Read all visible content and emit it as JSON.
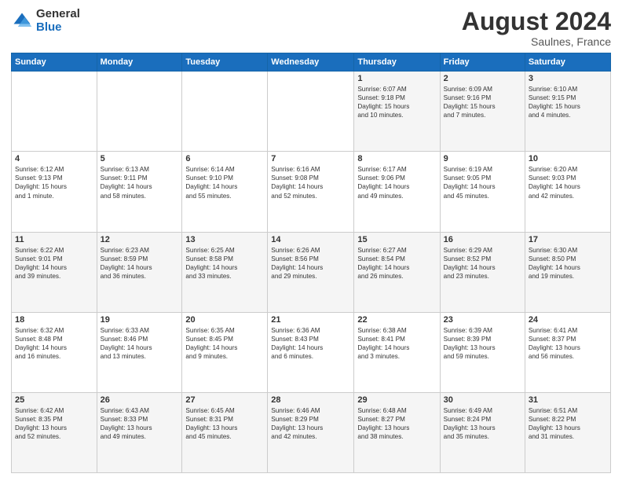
{
  "header": {
    "logo_general": "General",
    "logo_blue": "Blue",
    "month_year": "August 2024",
    "location": "Saulnes, France"
  },
  "weekdays": [
    "Sunday",
    "Monday",
    "Tuesday",
    "Wednesday",
    "Thursday",
    "Friday",
    "Saturday"
  ],
  "weeks": [
    [
      {
        "day": "",
        "info": ""
      },
      {
        "day": "",
        "info": ""
      },
      {
        "day": "",
        "info": ""
      },
      {
        "day": "",
        "info": ""
      },
      {
        "day": "1",
        "info": "Sunrise: 6:07 AM\nSunset: 9:18 PM\nDaylight: 15 hours\nand 10 minutes."
      },
      {
        "day": "2",
        "info": "Sunrise: 6:09 AM\nSunset: 9:16 PM\nDaylight: 15 hours\nand 7 minutes."
      },
      {
        "day": "3",
        "info": "Sunrise: 6:10 AM\nSunset: 9:15 PM\nDaylight: 15 hours\nand 4 minutes."
      }
    ],
    [
      {
        "day": "4",
        "info": "Sunrise: 6:12 AM\nSunset: 9:13 PM\nDaylight: 15 hours\nand 1 minute."
      },
      {
        "day": "5",
        "info": "Sunrise: 6:13 AM\nSunset: 9:11 PM\nDaylight: 14 hours\nand 58 minutes."
      },
      {
        "day": "6",
        "info": "Sunrise: 6:14 AM\nSunset: 9:10 PM\nDaylight: 14 hours\nand 55 minutes."
      },
      {
        "day": "7",
        "info": "Sunrise: 6:16 AM\nSunset: 9:08 PM\nDaylight: 14 hours\nand 52 minutes."
      },
      {
        "day": "8",
        "info": "Sunrise: 6:17 AM\nSunset: 9:06 PM\nDaylight: 14 hours\nand 49 minutes."
      },
      {
        "day": "9",
        "info": "Sunrise: 6:19 AM\nSunset: 9:05 PM\nDaylight: 14 hours\nand 45 minutes."
      },
      {
        "day": "10",
        "info": "Sunrise: 6:20 AM\nSunset: 9:03 PM\nDaylight: 14 hours\nand 42 minutes."
      }
    ],
    [
      {
        "day": "11",
        "info": "Sunrise: 6:22 AM\nSunset: 9:01 PM\nDaylight: 14 hours\nand 39 minutes."
      },
      {
        "day": "12",
        "info": "Sunrise: 6:23 AM\nSunset: 8:59 PM\nDaylight: 14 hours\nand 36 minutes."
      },
      {
        "day": "13",
        "info": "Sunrise: 6:25 AM\nSunset: 8:58 PM\nDaylight: 14 hours\nand 33 minutes."
      },
      {
        "day": "14",
        "info": "Sunrise: 6:26 AM\nSunset: 8:56 PM\nDaylight: 14 hours\nand 29 minutes."
      },
      {
        "day": "15",
        "info": "Sunrise: 6:27 AM\nSunset: 8:54 PM\nDaylight: 14 hours\nand 26 minutes."
      },
      {
        "day": "16",
        "info": "Sunrise: 6:29 AM\nSunset: 8:52 PM\nDaylight: 14 hours\nand 23 minutes."
      },
      {
        "day": "17",
        "info": "Sunrise: 6:30 AM\nSunset: 8:50 PM\nDaylight: 14 hours\nand 19 minutes."
      }
    ],
    [
      {
        "day": "18",
        "info": "Sunrise: 6:32 AM\nSunset: 8:48 PM\nDaylight: 14 hours\nand 16 minutes."
      },
      {
        "day": "19",
        "info": "Sunrise: 6:33 AM\nSunset: 8:46 PM\nDaylight: 14 hours\nand 13 minutes."
      },
      {
        "day": "20",
        "info": "Sunrise: 6:35 AM\nSunset: 8:45 PM\nDaylight: 14 hours\nand 9 minutes."
      },
      {
        "day": "21",
        "info": "Sunrise: 6:36 AM\nSunset: 8:43 PM\nDaylight: 14 hours\nand 6 minutes."
      },
      {
        "day": "22",
        "info": "Sunrise: 6:38 AM\nSunset: 8:41 PM\nDaylight: 14 hours\nand 3 minutes."
      },
      {
        "day": "23",
        "info": "Sunrise: 6:39 AM\nSunset: 8:39 PM\nDaylight: 13 hours\nand 59 minutes."
      },
      {
        "day": "24",
        "info": "Sunrise: 6:41 AM\nSunset: 8:37 PM\nDaylight: 13 hours\nand 56 minutes."
      }
    ],
    [
      {
        "day": "25",
        "info": "Sunrise: 6:42 AM\nSunset: 8:35 PM\nDaylight: 13 hours\nand 52 minutes."
      },
      {
        "day": "26",
        "info": "Sunrise: 6:43 AM\nSunset: 8:33 PM\nDaylight: 13 hours\nand 49 minutes."
      },
      {
        "day": "27",
        "info": "Sunrise: 6:45 AM\nSunset: 8:31 PM\nDaylight: 13 hours\nand 45 minutes."
      },
      {
        "day": "28",
        "info": "Sunrise: 6:46 AM\nSunset: 8:29 PM\nDaylight: 13 hours\nand 42 minutes."
      },
      {
        "day": "29",
        "info": "Sunrise: 6:48 AM\nSunset: 8:27 PM\nDaylight: 13 hours\nand 38 minutes."
      },
      {
        "day": "30",
        "info": "Sunrise: 6:49 AM\nSunset: 8:24 PM\nDaylight: 13 hours\nand 35 minutes."
      },
      {
        "day": "31",
        "info": "Sunrise: 6:51 AM\nSunset: 8:22 PM\nDaylight: 13 hours\nand 31 minutes."
      }
    ]
  ]
}
